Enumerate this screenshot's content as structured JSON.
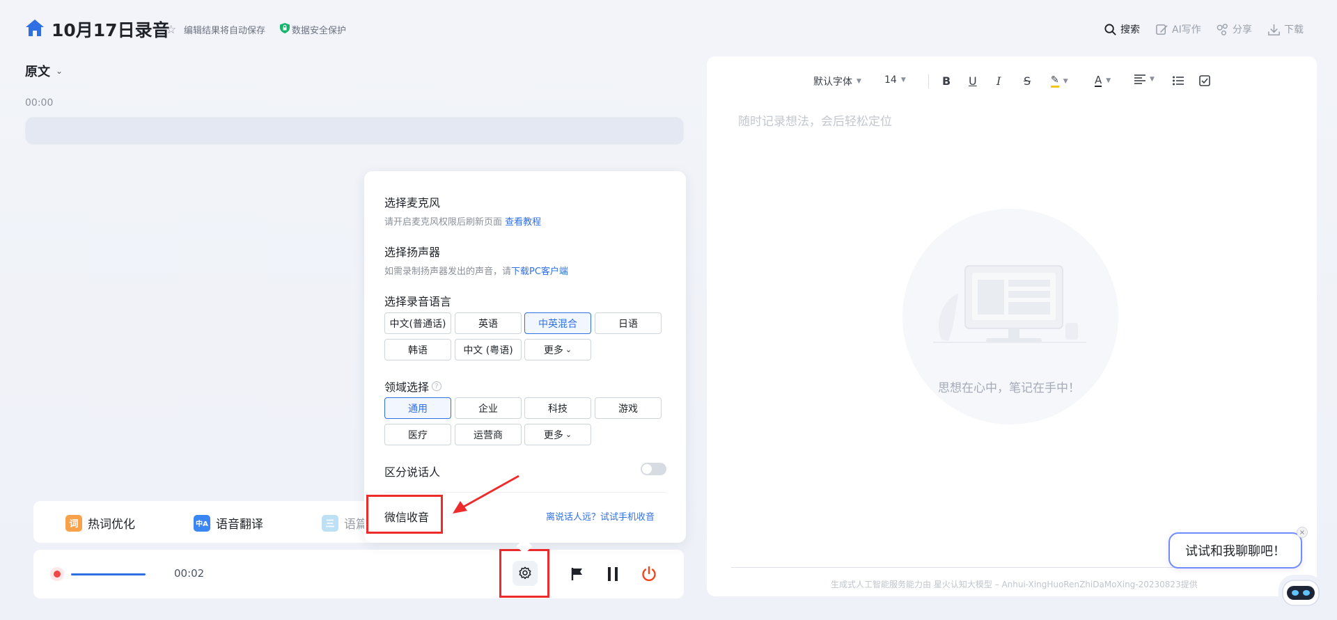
{
  "header": {
    "title": "10月17日录音",
    "autosave_text": "编辑结果将自动保存",
    "secure_text": "数据安全保护",
    "tools": [
      {
        "label": "搜索",
        "icon": "search-icon"
      },
      {
        "label": "AI写作",
        "icon": "ai-write-icon"
      },
      {
        "label": "分享",
        "icon": "share-icon"
      },
      {
        "label": "下载",
        "icon": "download-icon"
      }
    ]
  },
  "transcript": {
    "view_label": "原文",
    "time_top": "00:00"
  },
  "features": [
    {
      "label": "热词优化",
      "icon_text": "词",
      "color": "#f7a24b"
    },
    {
      "label": "语音翻译",
      "icon_text": "中A",
      "color": "#3a86f5"
    },
    {
      "label": "语篇",
      "icon_text": "三",
      "color": "#bde0f5"
    }
  ],
  "recorder": {
    "elapsed": "00:02"
  },
  "settings_popup": {
    "mic_title": "选择麦克风",
    "mic_sub": "请开启麦克风权限后刷新页面",
    "mic_link": "查看教程",
    "speaker_title": "选择扬声器",
    "speaker_sub": "如需录制扬声器发出的声音，请",
    "speaker_link": "下载PC客户端",
    "lang_title": "选择录音语言",
    "languages": [
      "中文(普通话)",
      "英语",
      "中英混合",
      "日语",
      "韩语",
      "中文 (粤语)",
      "更多"
    ],
    "selected_language": "中英混合",
    "domain_title": "领域选择",
    "domains": [
      "通用",
      "企业",
      "科技",
      "游戏",
      "医疗",
      "运营商",
      "更多"
    ],
    "selected_domain": "通用",
    "speaker_split_label": "区分说话人",
    "speaker_split_on": false,
    "wechat_label": "微信收音",
    "remote_hint": "离说话人远？试试手机收音"
  },
  "editor": {
    "font_family": "默认字体",
    "font_size": "14",
    "placeholder": "随时记录想法，会后轻松定位",
    "empty_text": "思想在心中，笔记在手中！",
    "footer": "生成式人工智能服务能力由 星火认知大模型 – Anhui-XingHuoRenZhiDaMoXing-20230823提供"
  },
  "assistant": {
    "bubble_text": "试试和我聊聊吧！"
  },
  "colors": {
    "accent": "#2f6fe4",
    "annotation_red": "#ee2a2a",
    "record_red": "#f04848"
  }
}
